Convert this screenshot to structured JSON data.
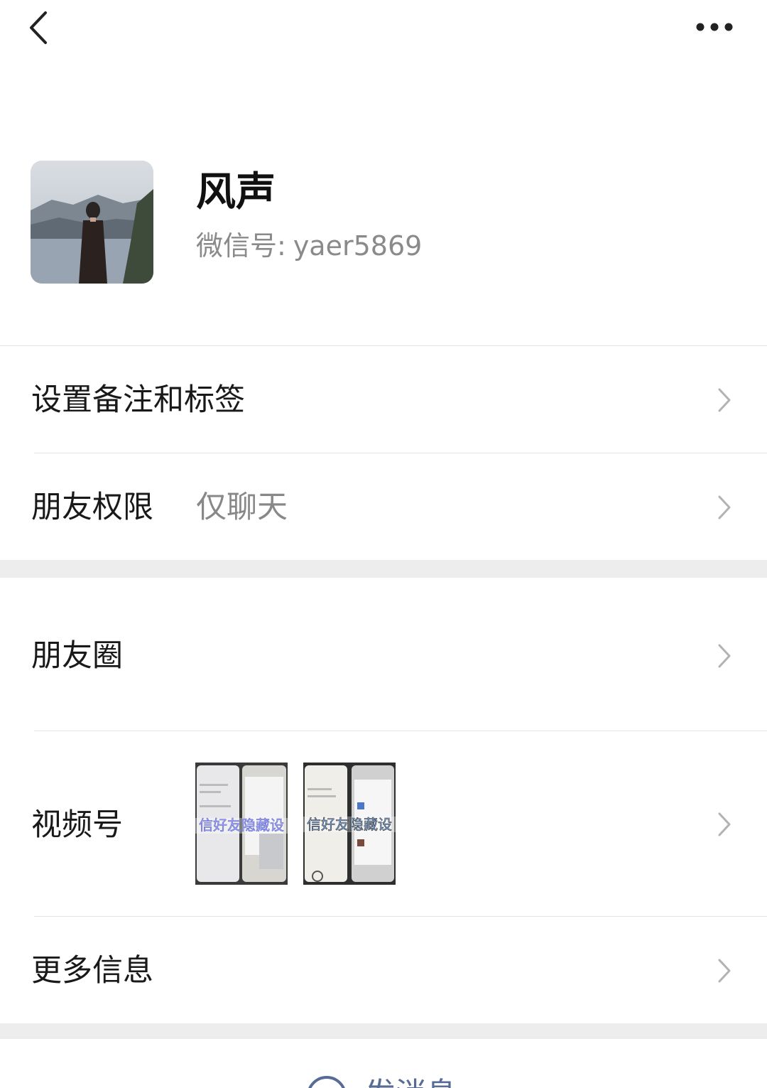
{
  "topbar": {
    "back_icon": "chevron-left-icon",
    "more_icon": "more-dots-icon"
  },
  "profile": {
    "name": "风声",
    "wechat_id_label": "微信号:",
    "wechat_id": "yaer5869"
  },
  "rows": {
    "remark_label": "设置备注和标签",
    "permission_label": "朋友权限",
    "permission_value": "仅聊天",
    "moments_label": "朋友圈",
    "channels_label": "视频号",
    "channels_thumb_1_caption": "信好友隐藏设",
    "channels_thumb_2_caption": "信好友隐藏设",
    "more_info_label": "更多信息"
  },
  "bottom": {
    "send_message_label": "发消息"
  },
  "colors": {
    "background": "#ffffff",
    "section_gap": "#ededed",
    "link_blue": "#576b95",
    "secondary_text": "#888888"
  }
}
